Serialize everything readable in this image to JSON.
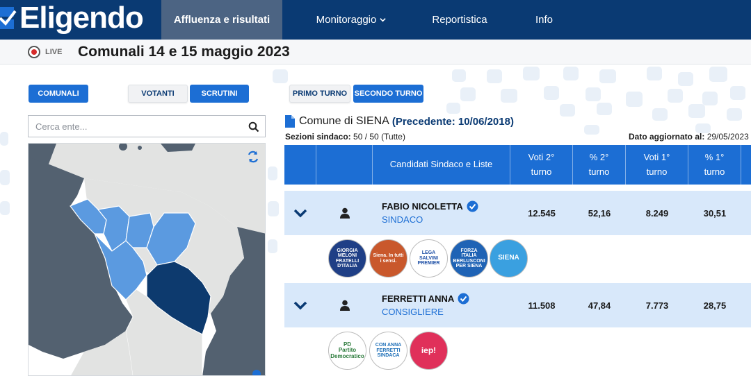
{
  "app": {
    "logo_text": "Eligendo"
  },
  "nav": {
    "items": [
      {
        "label": "Affluenza e risultati",
        "active": true
      },
      {
        "label": "Monitoraggio",
        "dropdown": true
      },
      {
        "label": "Reportistica"
      },
      {
        "label": "Info"
      }
    ]
  },
  "titlebar": {
    "live_label": "LIVE",
    "title": "Comunali 14 e 15 maggio 2023"
  },
  "controls": {
    "comunali": "COMUNALI",
    "votanti": "VOTANTI",
    "scrutini": "SCRUTINI",
    "primo_turno": "PRIMO TURNO",
    "secondo_turno": "SECONDO TURNO"
  },
  "search": {
    "placeholder": "Cerca ente..."
  },
  "panel": {
    "commune_name": "Comune di SIENA",
    "previous": "(Precedente: 10/06/2018)",
    "sezioni_label": "Sezioni sindaco:",
    "sezioni_value": "50 / 50 (Tutte)",
    "updated_label": "Dato aggiornato al:",
    "updated_value": "29/05/2023"
  },
  "table": {
    "headers": {
      "candidates": "Candidati Sindaco e Liste",
      "voti2": "Voti 2°\nturno",
      "pct2": "% 2°\nturno",
      "voti1": "Voti 1°\nturno",
      "pct1": "% 1°\nturno"
    },
    "rows": [
      {
        "name": "FABIO NICOLETTA",
        "role": "SINDACO",
        "voti2": "12.545",
        "pct2": "52,16",
        "voti1": "8.249",
        "pct1": "30,51",
        "lists": [
          {
            "name": "GIORGIA MELONI\nFRATELLI D'ITALIA",
            "color": "#1f3f86"
          },
          {
            "name": "Siena. In tutti i sensi.",
            "color": "#c9582c"
          },
          {
            "name": "LEGA SALVINI PREMIER",
            "color": "#1d4fa6"
          },
          {
            "name": "FORZA ITALIA BERLUSCONI PER SIENA",
            "color": "#1f63b5"
          },
          {
            "name": "SIENA",
            "color": "#3aa0e0"
          }
        ]
      },
      {
        "name": "FERRETTI ANNA",
        "role": "CONSIGLIERE",
        "voti2": "11.508",
        "pct2": "47,84",
        "voti1": "7.773",
        "pct1": "28,75",
        "lists": [
          {
            "name": "PD\nPartito Democratico",
            "color": "#ffffff"
          },
          {
            "name": "CON ANNA FERRETTI SINDACA",
            "color": "#ffffff"
          },
          {
            "name": "iep!",
            "color": "#e0305a"
          }
        ]
      }
    ]
  },
  "colors": {
    "navbar": "#0a3a73",
    "accent": "#1c6ed4",
    "row_bg": "#d8e8fa",
    "map_highlight": "#0d3a6e",
    "map_light": "#5b9ae0"
  }
}
